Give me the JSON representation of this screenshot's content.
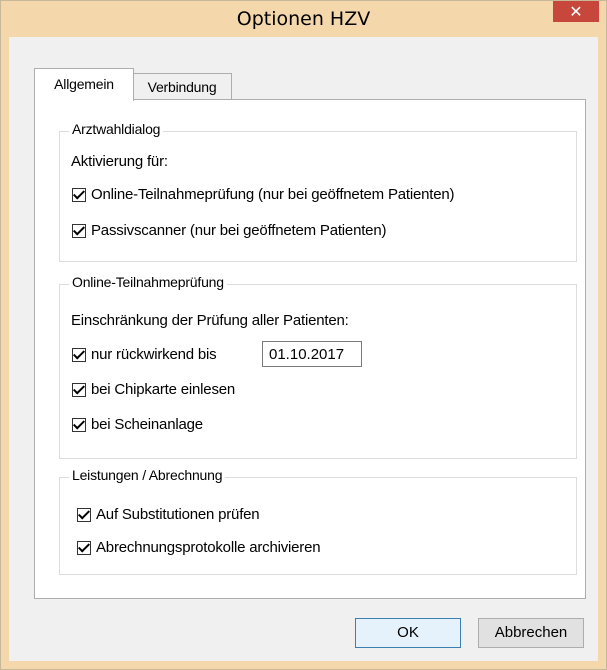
{
  "window": {
    "title": "Optionen HZV",
    "close_glyph": "✕"
  },
  "tabs": [
    {
      "label": "Allgemein",
      "active": true
    },
    {
      "label": "Verbindung",
      "active": false
    }
  ],
  "groups": {
    "arztwahl": {
      "legend": "Arztwahldialog",
      "subtitle": "Aktivierung für:",
      "options": [
        {
          "label": "Online-Teilnahmeprüfung (nur bei geöffnetem Patienten)",
          "checked": true
        },
        {
          "label": "Passivscanner (nur bei geöffnetem Patienten)",
          "checked": true
        }
      ]
    },
    "online": {
      "legend": "Online-Teilnahmeprüfung",
      "subtitle": "Einschränkung der Prüfung aller Patienten:",
      "options": [
        {
          "label": "nur rückwirkend bis",
          "checked": true
        },
        {
          "label": "bei Chipkarte einlesen",
          "checked": true
        },
        {
          "label": "bei Scheinanlage",
          "checked": true
        }
      ],
      "date_value": "01.10.2017"
    },
    "leistungen": {
      "legend": "Leistungen / Abrechnung",
      "options": [
        {
          "label": "Auf Substitutionen prüfen",
          "checked": true
        },
        {
          "label": "Abrechnungsprotokolle archivieren",
          "checked": true
        }
      ]
    }
  },
  "buttons": {
    "ok": "OK",
    "cancel": "Abbrechen"
  }
}
